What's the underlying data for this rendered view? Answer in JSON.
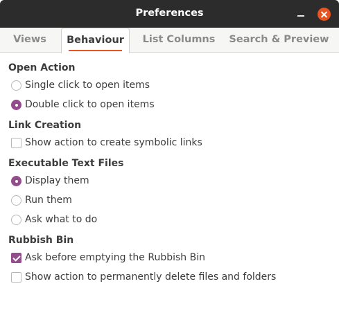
{
  "window": {
    "title": "Preferences"
  },
  "tabs": [
    {
      "label": "Views",
      "active": false
    },
    {
      "label": "Behaviour",
      "active": true
    },
    {
      "label": "List Columns",
      "active": false
    },
    {
      "label": "Search & Preview",
      "active": false
    }
  ],
  "sections": {
    "open_action": {
      "heading": "Open Action",
      "options": [
        {
          "label": "Single click to open items",
          "selected": false
        },
        {
          "label": "Double click to open items",
          "selected": true
        }
      ]
    },
    "link_creation": {
      "heading": "Link Creation",
      "options": [
        {
          "label": "Show action to create symbolic links",
          "checked": false
        }
      ]
    },
    "executable_text_files": {
      "heading": "Executable Text Files",
      "options": [
        {
          "label": "Display them",
          "selected": true
        },
        {
          "label": "Run them",
          "selected": false
        },
        {
          "label": "Ask what to do",
          "selected": false
        }
      ]
    },
    "rubbish_bin": {
      "heading": "Rubbish Bin",
      "options": [
        {
          "label": "Ask before emptying the Rubbish Bin",
          "checked": true
        },
        {
          "label": "Show action to permanently delete files and folders",
          "checked": false
        }
      ]
    }
  },
  "colors": {
    "titlebar": "#2c2c2c",
    "close_button": "#e95420",
    "tab_underline": "#e95420",
    "selection_accent": "#924d8b"
  }
}
